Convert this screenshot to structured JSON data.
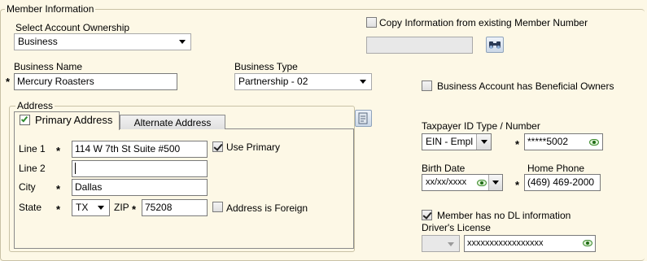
{
  "group": {
    "title": "Member Information"
  },
  "ownership": {
    "label": "Select Account Ownership",
    "value": "Business"
  },
  "copy_info": {
    "label": "Copy Information from existing Member Number",
    "checked": false,
    "member_number": ""
  },
  "business_name": {
    "label": "Business Name",
    "value": "Mercury Roasters"
  },
  "business_type": {
    "label": "Business Type",
    "value": "Partnership - 02"
  },
  "beneficial_owners": {
    "label": "Business Account has Beneficial Owners",
    "checked": false
  },
  "address": {
    "label": "Address",
    "tabs": [
      "Primary Address",
      "Alternate Address"
    ],
    "line1": {
      "label": "Line 1",
      "value": "114 W 7th St Suite #500"
    },
    "use_primary": {
      "label": "Use Primary",
      "checked": true
    },
    "line2": {
      "label": "Line 2",
      "value": ""
    },
    "city": {
      "label": "City",
      "value": "Dallas"
    },
    "state": {
      "label": "State",
      "value": "TX"
    },
    "zip": {
      "label": "ZIP",
      "value": "75208"
    },
    "foreign": {
      "label": "Address is Foreign",
      "checked": false
    }
  },
  "taxpayer": {
    "label": "Taxpayer ID Type / Number",
    "type": "EIN - Empl",
    "number": "*****5002"
  },
  "birth_date": {
    "label": "Birth Date",
    "value": "xx/xx/xxxx"
  },
  "home_phone": {
    "label": "Home Phone",
    "value": "(469) 469-2000"
  },
  "no_dl": {
    "label": "Member has no DL information",
    "checked": true
  },
  "drivers_license": {
    "label": "Driver's License",
    "state": "",
    "number": "xxxxxxxxxxxxxxxxx"
  },
  "required_marker": "*"
}
